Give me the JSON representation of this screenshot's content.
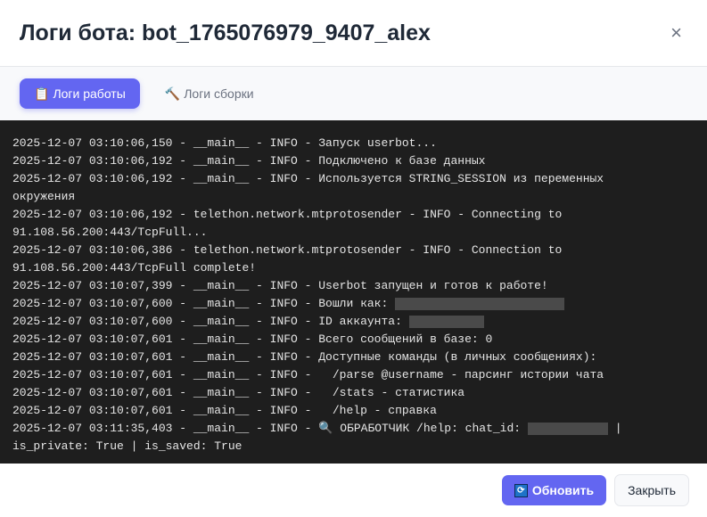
{
  "header": {
    "title": "Логи бота: bot_1765076979_9407_alex",
    "close": "×"
  },
  "tabs": [
    {
      "icon": "📋",
      "label": "Логи работы",
      "active": true
    },
    {
      "icon": "🔨",
      "label": "Логи сборки",
      "active": false
    }
  ],
  "logs": [
    {
      "text": "2025-12-07 03:10:06,150 - __main__ - INFO - Запуск userbot..."
    },
    {
      "text": "2025-12-07 03:10:06,192 - __main__ - INFO - Подключено к базе данных"
    },
    {
      "text": "2025-12-07 03:10:06,192 - __main__ - INFO - Используется STRING_SESSION из переменных окружения"
    },
    {
      "text": "2025-12-07 03:10:06,192 - telethon.network.mtprotosender - INFO - Connecting to 91.108.56.200:443/TcpFull..."
    },
    {
      "text": "2025-12-07 03:10:06,386 - telethon.network.mtprotosender - INFO - Connection to 91.108.56.200:443/TcpFull complete!"
    },
    {
      "text": "2025-12-07 03:10:07,399 - __main__ - INFO - Userbot запущен и готов к работе!"
    },
    {
      "text": "2025-12-07 03:10:07,600 - __main__ - INFO - Вошли как: ",
      "redacted": true,
      "suffix": ""
    },
    {
      "text": "2025-12-07 03:10:07,600 - __main__ - INFO - ID аккаунта: ",
      "redacted": true,
      "suffix": ""
    },
    {
      "text": "2025-12-07 03:10:07,601 - __main__ - INFO - Всего сообщений в базе: 0"
    },
    {
      "text": "2025-12-07 03:10:07,601 - __main__ - INFO - Доступные команды (в личных сообщениях):"
    },
    {
      "text": "2025-12-07 03:10:07,601 - __main__ - INFO -   /parse @username - парсинг истории чата"
    },
    {
      "text": "2025-12-07 03:10:07,601 - __main__ - INFO -   /stats - статистика"
    },
    {
      "text": "2025-12-07 03:10:07,601 - __main__ - INFO -   /help - справка"
    },
    {
      "text": "2025-12-07 03:11:35,403 - __main__ - INFO - 🔍 ОБРАБОТЧИК /help: chat_id: ",
      "redacted": true,
      "suffix": " | is_private: True | is_saved: True"
    }
  ],
  "footer": {
    "refresh_icon": "🔄",
    "refresh_label": "Обновить",
    "close_label": "Закрыть"
  },
  "colors": {
    "accent": "#6366f1",
    "terminal_bg": "#1e1e1e"
  }
}
